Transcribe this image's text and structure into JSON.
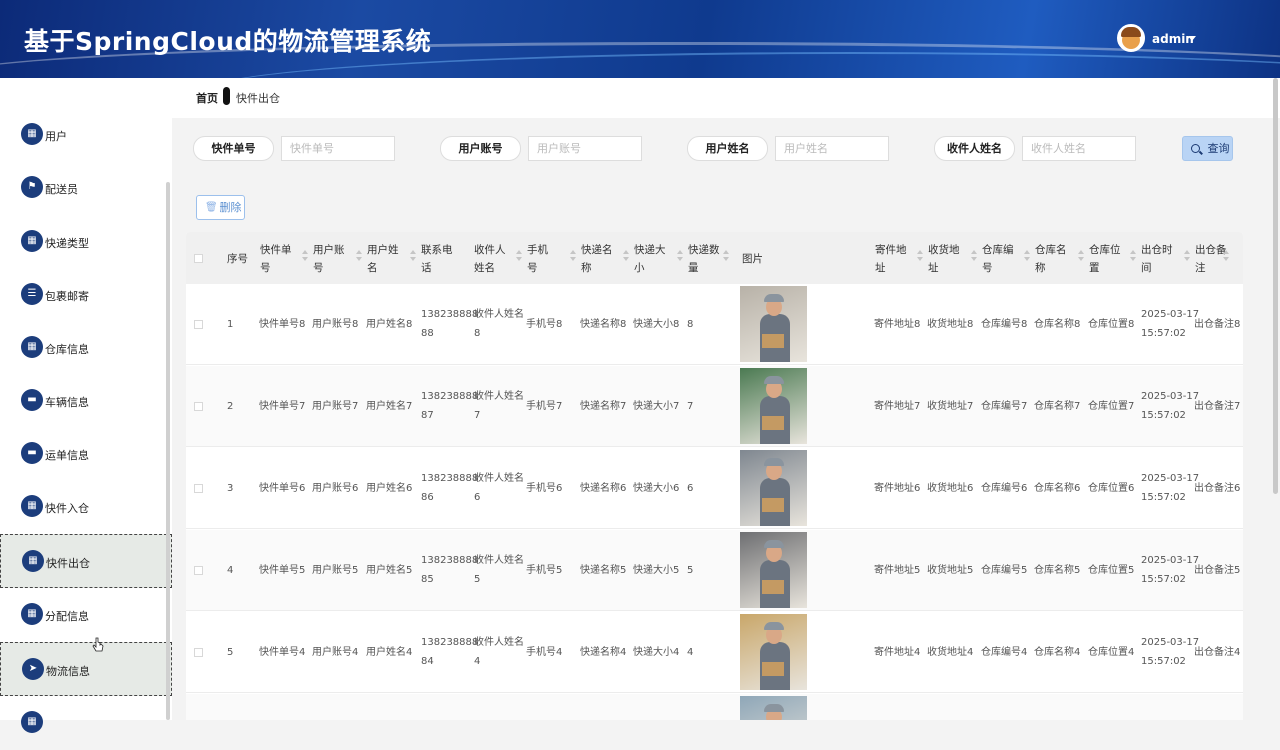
{
  "header": {
    "title": "基于SpringCloud的物流管理系统",
    "user": "admin"
  },
  "sidebar": {
    "items": [
      {
        "label": "用户",
        "icon": "grid-icon",
        "glyph": "▦"
      },
      {
        "label": "配送员",
        "icon": "flag-icon",
        "glyph": "⚑"
      },
      {
        "label": "快递类型",
        "icon": "grid-icon",
        "glyph": "▦"
      },
      {
        "label": "包裹邮寄",
        "icon": "list-icon",
        "glyph": "☰"
      },
      {
        "label": "仓库信息",
        "icon": "grid-icon",
        "glyph": "▦"
      },
      {
        "label": "车辆信息",
        "icon": "chat-icon",
        "glyph": "▬"
      },
      {
        "label": "运单信息",
        "icon": "chat-icon",
        "glyph": "▬"
      },
      {
        "label": "快件入仓",
        "icon": "grid-icon",
        "glyph": "▦"
      },
      {
        "label": "快件出仓",
        "icon": "grid-icon",
        "glyph": "▦"
      },
      {
        "label": "分配信息",
        "icon": "grid-icon",
        "glyph": "▦"
      },
      {
        "label": "物流信息",
        "icon": "send-icon",
        "glyph": "➤"
      },
      {
        "label": "",
        "icon": "grid-icon",
        "glyph": "▦"
      }
    ]
  },
  "breadcrumb": {
    "home": "首页",
    "current": "快件出仓"
  },
  "search": {
    "fields": [
      {
        "label": "快件单号",
        "placeholder": "快件单号"
      },
      {
        "label": "用户账号",
        "placeholder": "用户账号"
      },
      {
        "label": "用户姓名",
        "placeholder": "用户姓名"
      },
      {
        "label": "收件人姓名",
        "placeholder": "收件人姓名"
      }
    ],
    "query_label": "查询"
  },
  "toolbar": {
    "delete_label": "删除"
  },
  "table": {
    "headers": [
      {
        "l1": "序号",
        "l2": ""
      },
      {
        "l1": "快件单",
        "l2": "号"
      },
      {
        "l1": "用户账",
        "l2": "号"
      },
      {
        "l1": "用户姓",
        "l2": "名"
      },
      {
        "l1": "联系电",
        "l2": "话"
      },
      {
        "l1": "收件人",
        "l2": "姓名"
      },
      {
        "l1": "手机",
        "l2": "号"
      },
      {
        "l1": "快递名",
        "l2": "称"
      },
      {
        "l1": "快递大",
        "l2": "小"
      },
      {
        "l1": "快递数",
        "l2": "量"
      },
      {
        "l1": "图片",
        "l2": ""
      },
      {
        "l1": "寄件地",
        "l2": "址"
      },
      {
        "l1": "收货地",
        "l2": "址"
      },
      {
        "l1": "仓库编",
        "l2": "号"
      },
      {
        "l1": "仓库名",
        "l2": "称"
      },
      {
        "l1": "仓库位",
        "l2": "置"
      },
      {
        "l1": "出仓时",
        "l2": "间"
      },
      {
        "l1": "出仓备",
        "l2": "注"
      }
    ],
    "rows": [
      {
        "no": "1",
        "c1": "快件单号8",
        "c2": "用户账号8",
        "c3": "用户姓名8",
        "p1": "138238888",
        "p2": "88",
        "r1": "收件人姓名",
        "r2": "8",
        "c6": "手机号8",
        "c7": "快递名称8",
        "c8": "快递大小8",
        "c9": "8",
        "c11": "寄件地址8",
        "c12": "收货地址8",
        "c13": "仓库编号8",
        "c14": "仓库名称8",
        "c15": "仓库位置8",
        "t1": "2025-03-17",
        "t2": "15:57:02",
        "c17": "出仓备注8"
      },
      {
        "no": "2",
        "c1": "快件单号7",
        "c2": "用户账号7",
        "c3": "用户姓名7",
        "p1": "138238888",
        "p2": "87",
        "r1": "收件人姓名",
        "r2": "7",
        "c6": "手机号7",
        "c7": "快递名称7",
        "c8": "快递大小7",
        "c9": "7",
        "c11": "寄件地址7",
        "c12": "收货地址7",
        "c13": "仓库编号7",
        "c14": "仓库名称7",
        "c15": "仓库位置7",
        "t1": "2025-03-17",
        "t2": "15:57:02",
        "c17": "出仓备注7"
      },
      {
        "no": "3",
        "c1": "快件单号6",
        "c2": "用户账号6",
        "c3": "用户姓名6",
        "p1": "138238888",
        "p2": "86",
        "r1": "收件人姓名",
        "r2": "6",
        "c6": "手机号6",
        "c7": "快递名称6",
        "c8": "快递大小6",
        "c9": "6",
        "c11": "寄件地址6",
        "c12": "收货地址6",
        "c13": "仓库编号6",
        "c14": "仓库名称6",
        "c15": "仓库位置6",
        "t1": "2025-03-17",
        "t2": "15:57:02",
        "c17": "出仓备注6"
      },
      {
        "no": "4",
        "c1": "快件单号5",
        "c2": "用户账号5",
        "c3": "用户姓名5",
        "p1": "138238888",
        "p2": "85",
        "r1": "收件人姓名",
        "r2": "5",
        "c6": "手机号5",
        "c7": "快递名称5",
        "c8": "快递大小5",
        "c9": "5",
        "c11": "寄件地址5",
        "c12": "收货地址5",
        "c13": "仓库编号5",
        "c14": "仓库名称5",
        "c15": "仓库位置5",
        "t1": "2025-03-17",
        "t2": "15:57:02",
        "c17": "出仓备注5"
      },
      {
        "no": "5",
        "c1": "快件单号4",
        "c2": "用户账号4",
        "c3": "用户姓名4",
        "p1": "138238888",
        "p2": "84",
        "r1": "收件人姓名",
        "r2": "4",
        "c6": "手机号4",
        "c7": "快递名称4",
        "c8": "快递大小4",
        "c9": "4",
        "c11": "寄件地址4",
        "c12": "收货地址4",
        "c13": "仓库编号4",
        "c14": "仓库名称4",
        "c15": "仓库位置4",
        "t1": "2025-03-17",
        "t2": "15:57:02",
        "c17": "出仓备注4"
      }
    ],
    "thumb_colors": [
      "#b8b2a8",
      "#4b7a52",
      "#7f8790",
      "#6e6f72",
      "#c9a76a",
      "#8fa7b8"
    ]
  }
}
